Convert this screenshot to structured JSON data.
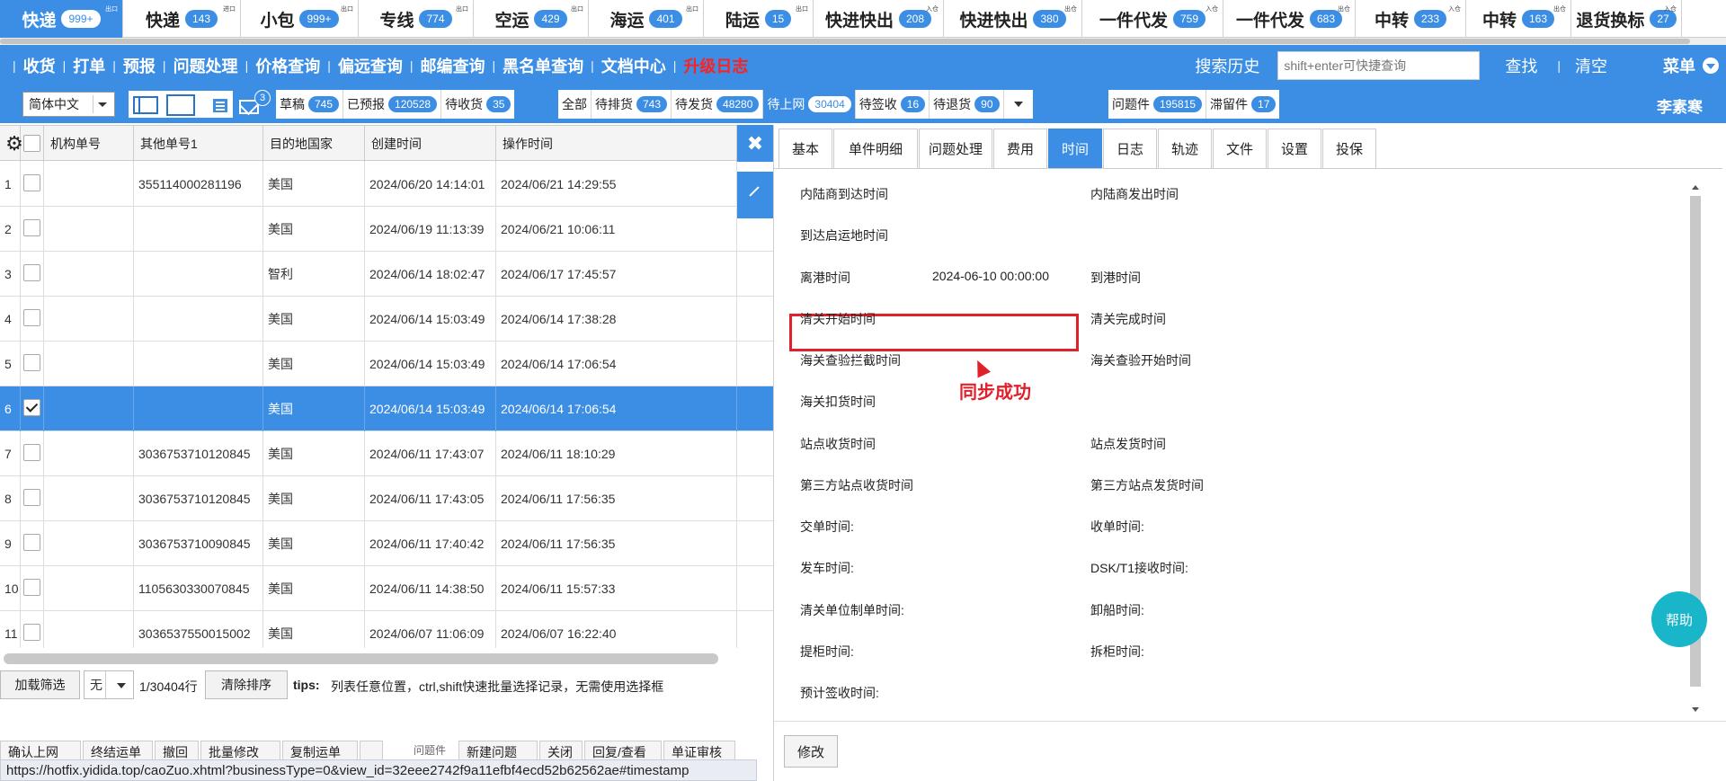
{
  "top_tabs": [
    {
      "label": "快递",
      "badge": "999+",
      "sup": "出口",
      "active": true
    },
    {
      "label": "快递",
      "badge": "143",
      "sup": "进口"
    },
    {
      "label": "小包",
      "badge": "999+",
      "sup": "出口"
    },
    {
      "label": "专线",
      "badge": "774",
      "sup": "出口"
    },
    {
      "label": "空运",
      "badge": "429",
      "sup": "出口"
    },
    {
      "label": "海运",
      "badge": "401",
      "sup": "出口"
    },
    {
      "label": "陆运",
      "badge": "15",
      "sup": "出口"
    },
    {
      "label": "快进快出",
      "badge": "208",
      "sup": "入仓"
    },
    {
      "label": "快进快出",
      "badge": "380",
      "sup": "出仓"
    },
    {
      "label": "一件代发",
      "badge": "759",
      "sup": "入仓"
    },
    {
      "label": "一件代发",
      "badge": "683",
      "sup": "出仓"
    },
    {
      "label": "中转",
      "badge": "233",
      "sup": "入仓"
    },
    {
      "label": "中转",
      "badge": "163",
      "sup": "出仓"
    },
    {
      "label": "退货换标",
      "badge": "27",
      "sup": "入仓"
    }
  ],
  "nav": {
    "items": [
      {
        "label": "收货"
      },
      {
        "label": "打单"
      },
      {
        "label": "预报"
      },
      {
        "label": "问题处理"
      },
      {
        "label": "价格查询"
      },
      {
        "label": "偏远查询"
      },
      {
        "label": "邮编查询"
      },
      {
        "label": "黑名单查询"
      },
      {
        "label": "文档中心"
      },
      {
        "label": "升级日志",
        "color": "#ff2020"
      }
    ],
    "search_history": "搜索历史",
    "search_placeholder": "shift+enter可快捷查询",
    "find": "查找",
    "clear": "清空",
    "menu": "菜单"
  },
  "toolbar": {
    "language": "简体中文",
    "mail_badge": "3",
    "group1": [
      {
        "label": "草稿",
        "badge": "745"
      },
      {
        "label": "已预报",
        "badge": "120528"
      },
      {
        "label": "待收货",
        "badge": "35"
      }
    ],
    "group2": [
      {
        "label": "全部",
        "badge": ""
      },
      {
        "label": "待排货",
        "badge": "743"
      },
      {
        "label": "待发货",
        "badge": "48280"
      },
      {
        "label": "待上网",
        "badge": "30404",
        "active": true
      },
      {
        "label": "待签收",
        "badge": "16"
      },
      {
        "label": "待退货",
        "badge": "90"
      }
    ],
    "group3": [
      {
        "label": "问题件",
        "badge": "195815"
      },
      {
        "label": "滞留件",
        "badge": "17"
      }
    ],
    "user": "李素寒"
  },
  "grid": {
    "columns": [
      "机构单号",
      "其他单号1",
      "目的地国家",
      "创建时间",
      "操作时间"
    ],
    "rows": [
      {
        "no": "1",
        "org": "",
        "other": "355114000281196",
        "country": "美国",
        "created": "2024/06/20 14:14:01",
        "operated": "2024/06/21 14:29:55",
        "checked": false
      },
      {
        "no": "2",
        "org": "",
        "other": "",
        "country": "美国",
        "created": "2024/06/19 11:13:39",
        "operated": "2024/06/21 10:06:11",
        "checked": false
      },
      {
        "no": "3",
        "org": "",
        "other": "",
        "country": "智利",
        "created": "2024/06/14 18:02:47",
        "operated": "2024/06/17 17:45:57",
        "checked": false
      },
      {
        "no": "4",
        "org": "",
        "other": "",
        "country": "美国",
        "created": "2024/06/14 15:03:49",
        "operated": "2024/06/14 17:38:28",
        "checked": false
      },
      {
        "no": "5",
        "org": "",
        "other": "",
        "country": "美国",
        "created": "2024/06/14 15:03:49",
        "operated": "2024/06/14 17:06:54",
        "checked": false
      },
      {
        "no": "6",
        "org": "",
        "other": "",
        "country": "美国",
        "created": "2024/06/14 15:03:49",
        "operated": "2024/06/14 17:06:54",
        "checked": true
      },
      {
        "no": "7",
        "org": "",
        "other": "3036753710120845",
        "country": "美国",
        "created": "2024/06/11 17:43:07",
        "operated": "2024/06/11 18:10:29",
        "checked": false
      },
      {
        "no": "8",
        "org": "",
        "other": "3036753710120845",
        "country": "美国",
        "created": "2024/06/11 17:43:05",
        "operated": "2024/06/11 17:56:35",
        "checked": false
      },
      {
        "no": "9",
        "org": "",
        "other": "3036753710090845",
        "country": "美国",
        "created": "2024/06/11 17:40:42",
        "operated": "2024/06/11 17:56:35",
        "checked": false
      },
      {
        "no": "10",
        "org": "",
        "other": "1105630330070845",
        "country": "美国",
        "created": "2024/06/11 14:38:50",
        "operated": "2024/06/11 15:57:33",
        "checked": false
      },
      {
        "no": "11",
        "org": "",
        "other": "3036537550015002",
        "country": "美国",
        "created": "2024/06/07 11:06:09",
        "operated": "2024/06/07 16:22:40",
        "checked": false
      }
    ]
  },
  "bottom": {
    "load_filter": "加载筛选",
    "filter_select": "无",
    "row_count": "1/30404行",
    "clear_sort": "清除排序",
    "tips_label": "tips:",
    "tips": "列表任意位置，ctrl,shift快速批量选择记录，无需使用选择框"
  },
  "actions": [
    "确认上网",
    "终结运单",
    "撤回",
    "批量修改",
    "复制运单",
    "",
    "问题件",
    "新建问题",
    "关闭",
    "回复/查看",
    "单证审核"
  ],
  "status_url": "https://hotfix.yidida.top/caoZuo.xhtml?businessType=0&view_id=32eee2742f9a11efbf4ecd52b62562ae#timestamp",
  "detail": {
    "tabs": [
      "基本",
      "单件明细",
      "问题处理",
      "费用",
      "时间",
      "日志",
      "轨迹",
      "文件",
      "设置",
      "投保"
    ],
    "active_tab": "时间",
    "fields": [
      {
        "label": "内陆商到达时间",
        "col": 0,
        "row": 0
      },
      {
        "label": "内陆商发出时间",
        "col": 1,
        "row": 0
      },
      {
        "label": "到达启运地时间",
        "col": 0,
        "row": 1
      },
      {
        "label": "离港时间",
        "col": 0,
        "row": 2,
        "value": "2024-06-10 00:00:00"
      },
      {
        "label": "到港时间",
        "col": 1,
        "row": 2
      },
      {
        "label": "清关开始时间",
        "col": 0,
        "row": 3
      },
      {
        "label": "清关完成时间",
        "col": 1,
        "row": 3
      },
      {
        "label": "海关查验拦截时间",
        "col": 0,
        "row": 4
      },
      {
        "label": "海关查验开始时间",
        "col": 1,
        "row": 4
      },
      {
        "label": "海关扣货时间",
        "col": 0,
        "row": 5
      },
      {
        "label": "站点收货时间",
        "col": 0,
        "row": 6
      },
      {
        "label": "站点发货时间",
        "col": 1,
        "row": 6
      },
      {
        "label": "第三方站点收货时间",
        "col": 0,
        "row": 7
      },
      {
        "label": "第三方站点发货时间",
        "col": 1,
        "row": 7
      },
      {
        "label": "交单时间:",
        "col": 0,
        "row": 8
      },
      {
        "label": "收单时间:",
        "col": 1,
        "row": 8
      },
      {
        "label": "发车时间:",
        "col": 0,
        "row": 9
      },
      {
        "label": "DSK/T1接收时间:",
        "col": 1,
        "row": 9
      },
      {
        "label": "清关单位制单时间:",
        "col": 0,
        "row": 10
      },
      {
        "label": "卸船时间:",
        "col": 1,
        "row": 10
      },
      {
        "label": "提柜时间:",
        "col": 0,
        "row": 11
      },
      {
        "label": "拆柜时间:",
        "col": 1,
        "row": 11
      },
      {
        "label": "预计签收时间:",
        "col": 0,
        "row": 12
      }
    ],
    "annotation": "同步成功",
    "help": "帮助",
    "edit": "修改"
  }
}
